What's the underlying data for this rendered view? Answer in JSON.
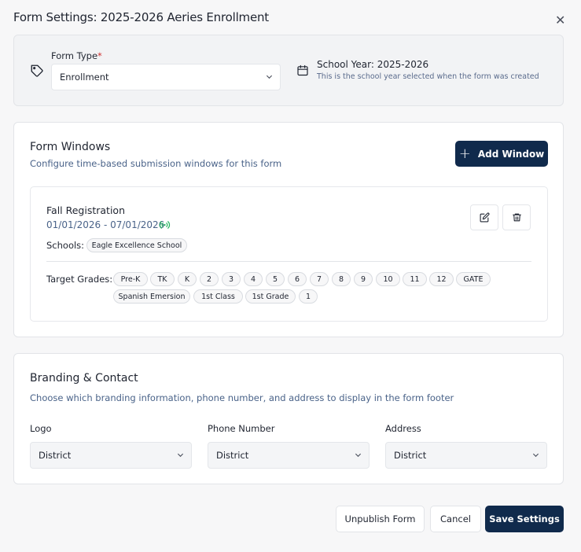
{
  "dialog": {
    "title": "Form Settings: 2025-2026 Aeries Enrollment",
    "close_icon": "close-icon"
  },
  "form_type": {
    "label": "Form Type",
    "required_mark": "*",
    "value": "Enrollment",
    "school_year": "School Year: 2025-2026",
    "school_year_note": "This is the school year selected when the form was created"
  },
  "windows": {
    "title": "Form Windows",
    "subtitle": "Configure time-based submission windows for this form",
    "add_button": "Add Window",
    "items": [
      {
        "name": "Fall Registration",
        "dates": "01/01/2026 - 07/01/2026",
        "schools_label": "Schools:",
        "schools": [
          "Eagle Excellence School"
        ],
        "grades_label": "Target Grades:",
        "grades": [
          "Pre-K",
          "TK",
          "K",
          "2",
          "3",
          "4",
          "5",
          "6",
          "7",
          "8",
          "9",
          "10",
          "11",
          "12",
          "GATE",
          "Spanish Emersion",
          "1st Class",
          "1st Grade",
          "1"
        ]
      }
    ]
  },
  "branding": {
    "title": "Branding & Contact",
    "subtitle": "Choose which branding information, phone number, and address to display in the form footer",
    "logo_label": "Logo",
    "logo_value": "District",
    "phone_label": "Phone Number",
    "phone_value": "District",
    "address_label": "Address",
    "address_value": "District"
  },
  "footer": {
    "unpublish": "Unpublish Form",
    "cancel": "Cancel",
    "save": "Save Settings"
  },
  "colors": {
    "primary": "#102a4c",
    "active": "#22b35e",
    "required": "#d03030",
    "muted_text": "#4a6389"
  }
}
